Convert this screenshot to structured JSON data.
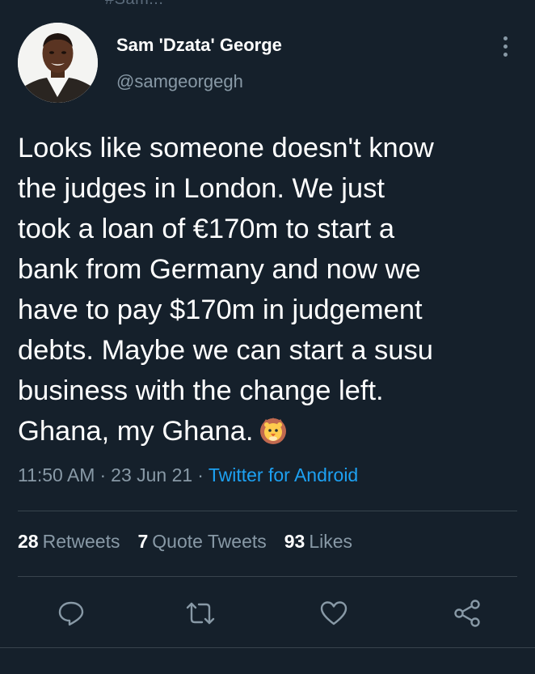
{
  "top_hint": "#Sam...",
  "author": {
    "display_name": "Sam 'Dzata' George",
    "handle": "@samgeorgegh"
  },
  "tweet": {
    "lines": [
      "Looks like someone doesn't know",
      "the judges in London. We just",
      "took a loan of €170m to start a",
      "bank from Germany and now we",
      "have to pay $170m in judgement",
      "debts. Maybe we can start a susu",
      "business with the change left.",
      "Ghana, my Ghana."
    ],
    "emoji": "lion-face"
  },
  "meta": {
    "time": "11:50 AM",
    "date": "23 Jun 21",
    "separator": "·",
    "source": "Twitter for Android"
  },
  "stats": {
    "retweets_count": "28",
    "retweets_label": "Retweets",
    "quotes_count": "7",
    "quotes_label": "Quote Tweets",
    "likes_count": "93",
    "likes_label": "Likes"
  },
  "actions": [
    "reply-icon",
    "retweet-icon",
    "like-icon",
    "share-icon"
  ],
  "colors": {
    "background": "#15202b",
    "text": "#ffffff",
    "muted": "#8899a6",
    "link": "#1da1f2",
    "divider": "#38444d"
  }
}
